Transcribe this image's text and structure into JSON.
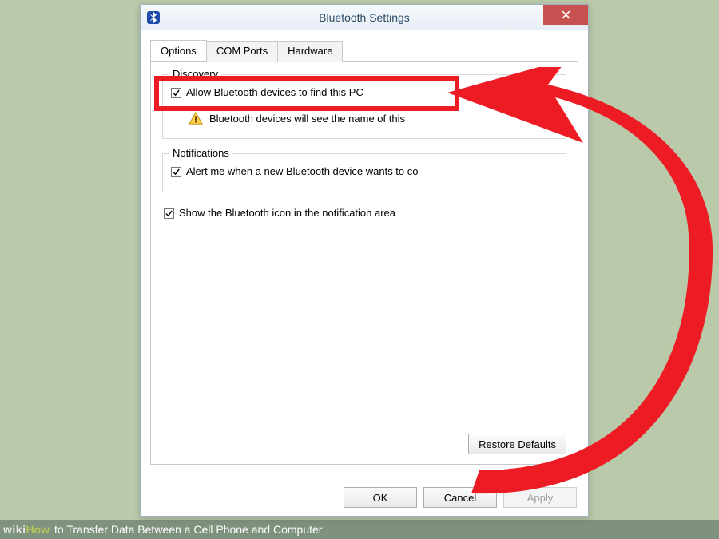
{
  "window": {
    "title": "Bluetooth Settings"
  },
  "tabs": [
    {
      "label": "Options",
      "active": true
    },
    {
      "label": "COM Ports",
      "active": false
    },
    {
      "label": "Hardware",
      "active": false
    }
  ],
  "discovery": {
    "legend": "Discovery",
    "allow_label": "Allow Bluetooth devices to find this PC",
    "allow_checked": true,
    "warning_text": "Bluetooth devices will see the name of this"
  },
  "notifications": {
    "legend": "Notifications",
    "alert_label": "Alert me when a new Bluetooth device wants to co",
    "alert_checked": true
  },
  "show_tray": {
    "label": "Show the Bluetooth icon in the notification area",
    "checked": true
  },
  "buttons": {
    "restore": "Restore Defaults",
    "ok": "OK",
    "cancel": "Cancel",
    "apply": "Apply"
  },
  "caption": {
    "brand_pre": "wiki",
    "brand_suf": "How",
    "text": " to Transfer Data Between a Cell Phone and Computer"
  },
  "accent": {
    "highlight": "#ed1c24"
  }
}
